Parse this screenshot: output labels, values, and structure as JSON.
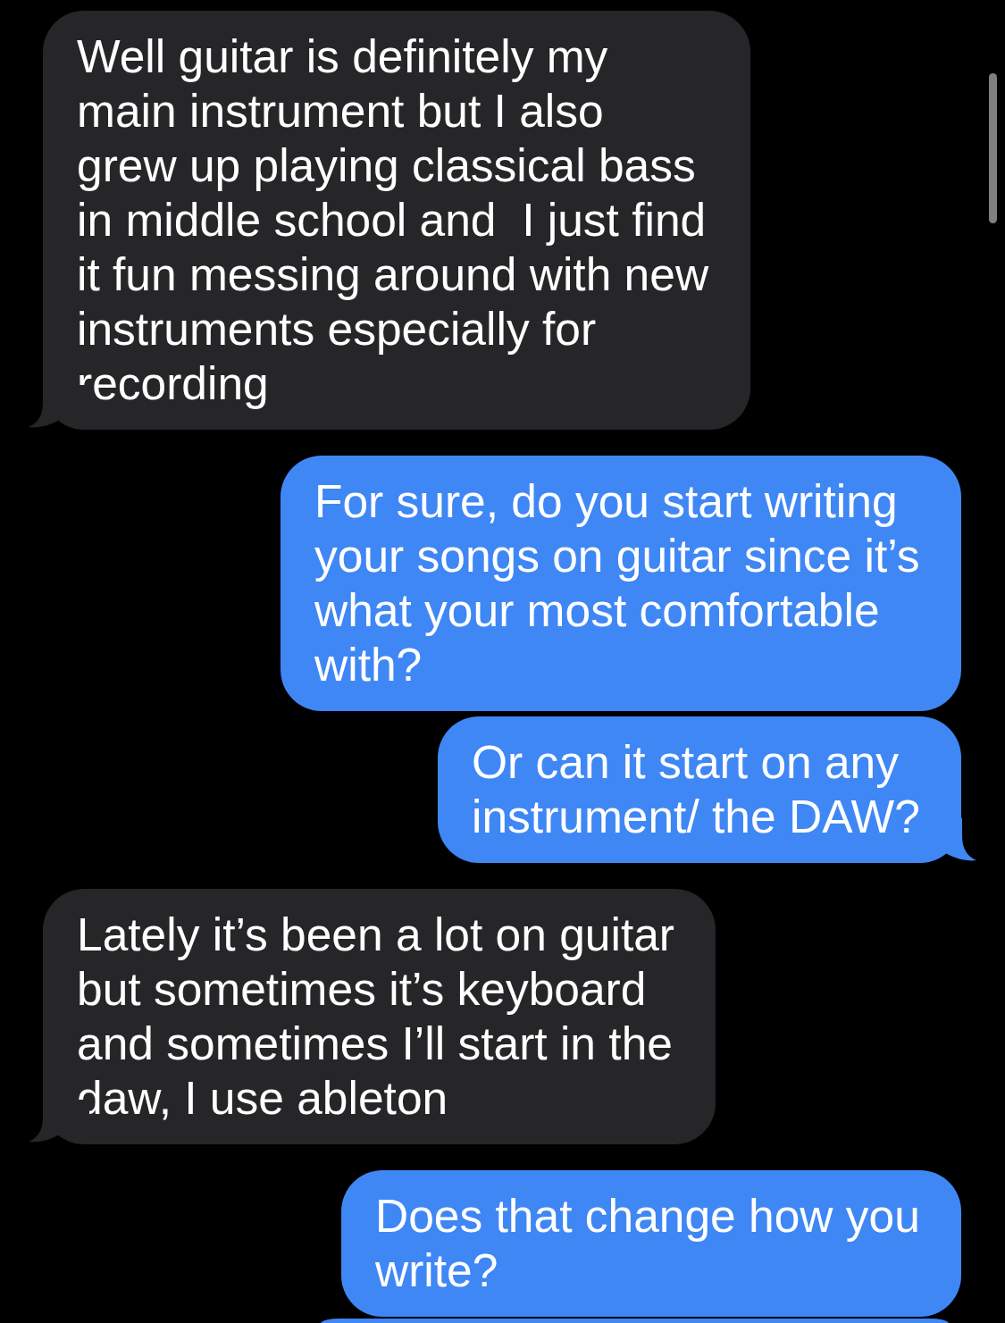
{
  "messages": [
    {
      "kind": "received",
      "text": "Well guitar is definitely my main instrument but I also grew up playing classical bass in middle school and  I just find it fun messing around with new instruments especially for recording",
      "tail": true
    },
    {
      "kind": "sent",
      "text": "For sure, do you start writing your songs on guitar since it’s what your most comfortable with?",
      "tail": false
    },
    {
      "kind": "sent",
      "text": "Or can it start on any instrument/ the DAW?",
      "tail": true
    },
    {
      "kind": "received",
      "text": "Lately it’s been a lot on guitar but sometimes it’s keyboard and sometimes I’ll start in the daw, I use ableton",
      "tail": true
    },
    {
      "kind": "sent",
      "text": "Does that change how you write?",
      "tail": false
    },
    {
      "kind": "sent"
    }
  ]
}
